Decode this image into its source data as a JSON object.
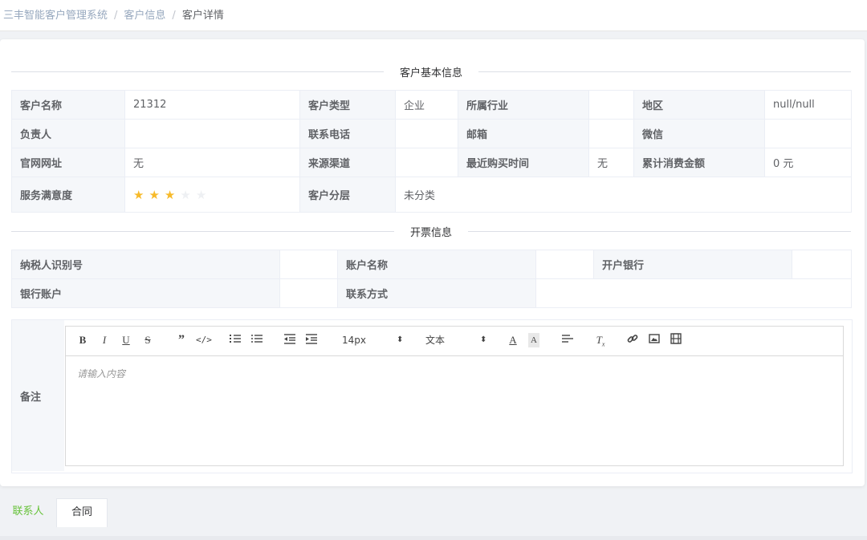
{
  "breadcrumb": {
    "items": [
      "三丰智能客户管理系统",
      "客户信息"
    ],
    "current": "客户详情"
  },
  "basic_info": {
    "title": "客户基本信息",
    "rows": [
      [
        {
          "label": "客户名称",
          "value": "21312"
        },
        {
          "label": "客户类型",
          "value": "企业"
        },
        {
          "label": "所属行业",
          "value": ""
        },
        {
          "label": "地区",
          "value": "null/null"
        }
      ],
      [
        {
          "label": "负责人",
          "value": ""
        },
        {
          "label": "联系电话",
          "value": ""
        },
        {
          "label": "邮箱",
          "value": ""
        },
        {
          "label": "微信",
          "value": ""
        }
      ],
      [
        {
          "label": "官网网址",
          "value": "无"
        },
        {
          "label": "来源渠道",
          "value": ""
        },
        {
          "label": "最近购买时间",
          "value": "无"
        },
        {
          "label": "累计消费金额",
          "value": "0 元"
        }
      ]
    ],
    "satisfaction_label": "服务满意度",
    "satisfaction_rating": 3,
    "satisfaction_max": 5,
    "tier_label": "客户分层",
    "tier_value": "未分类"
  },
  "invoice": {
    "title": "开票信息",
    "taxpayer_label": "纳税人识别号",
    "taxpayer_value": "",
    "account_name_label": "账户名称",
    "account_name_value": "",
    "bank_label": "开户银行",
    "bank_value": "",
    "bank_account_label": "银行账户",
    "bank_account_value": "",
    "contact_label": "联系方式",
    "contact_value": ""
  },
  "remark": {
    "label": "备注",
    "placeholder": "请输入内容",
    "font_size": "14px",
    "text_type": "文本",
    "toolbar_icons": [
      "bold-icon",
      "italic-icon",
      "underline-icon",
      "strike-icon",
      "quote-icon",
      "code-icon",
      "ordered-list-icon",
      "bullet-list-icon",
      "outdent-icon",
      "indent-icon",
      "font-color-icon",
      "background-color-icon",
      "align-icon",
      "clear-format-icon",
      "link-icon",
      "image-icon",
      "video-icon"
    ]
  },
  "tabs": [
    {
      "label": "联系人",
      "active": true
    },
    {
      "label": "合同",
      "active": false
    }
  ],
  "colors": {
    "accent": "#67c23a",
    "star": "#f7ba2a",
    "label_bg": "#f5f7fa"
  }
}
